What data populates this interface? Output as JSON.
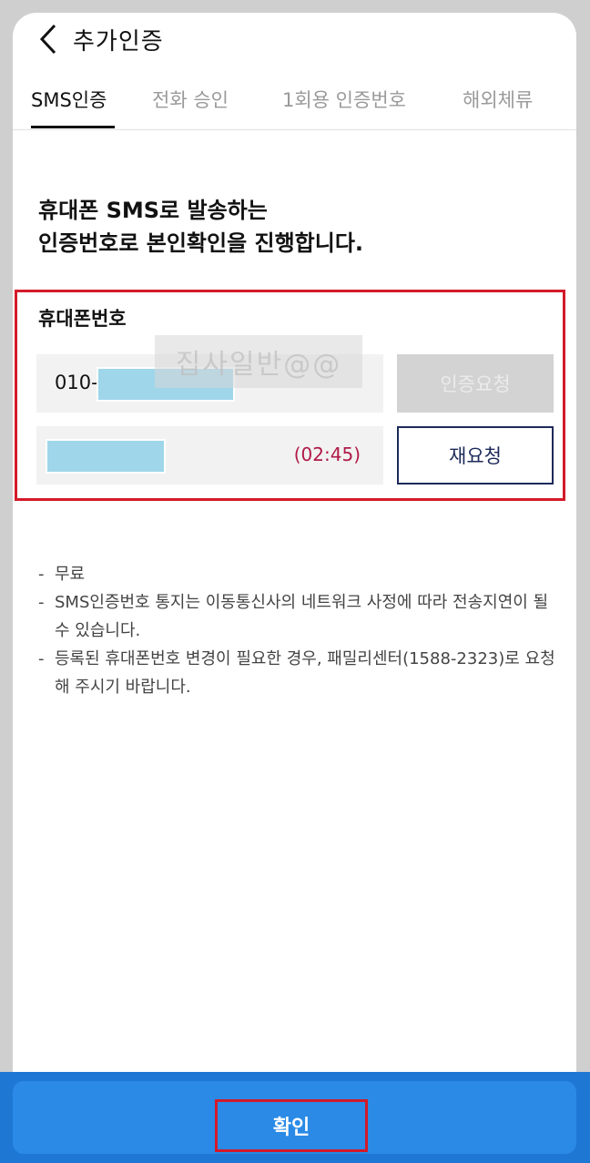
{
  "header": {
    "title": "추가인증",
    "back_icon": "chevron-left-icon"
  },
  "tabs": [
    {
      "label": "SMS인증",
      "active": true
    },
    {
      "label": "전화 승인",
      "active": false
    },
    {
      "label": "1회용 인증번호",
      "active": false
    },
    {
      "label": "해외체류",
      "active": false
    }
  ],
  "main": {
    "headline_line1": "휴대폰 SMS로 발송하는",
    "headline_line2": "인증번호로 본인확인을 진행합니다.",
    "phone_label": "휴대폰번호",
    "phone_prefix": "010-",
    "request_button": "인증요청",
    "timer": "(02:45)",
    "resend_button": "재요청",
    "watermark": "집사일반@@"
  },
  "notes": [
    "무료",
    "SMS인증번호 통지는 이동통신사의 네트워크 사정에 따라 전송지연이 될 수 있습니다.",
    "등록된 휴대폰번호 변경이 필요한 경우, 패밀리센터(1588-2323)로 요청해 주시기 바랍니다."
  ],
  "footer": {
    "confirm_label": "확인"
  },
  "colors": {
    "accent_blue": "#2a8ae6",
    "highlight_red": "#d31a2a",
    "timer": "#b01a48",
    "navy": "#1d2a5a"
  }
}
